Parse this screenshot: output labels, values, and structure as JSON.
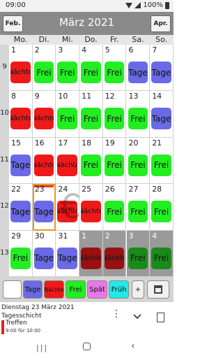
{
  "status": {
    "time": "09:00",
    "battery": "100%"
  },
  "header": {
    "prev_label": "Feb.",
    "title": "März 2021",
    "next_label": "Apr."
  },
  "weekdays": [
    "Mo.",
    "Di.",
    "Mi.",
    "Do.",
    "Fr.",
    "Sa.",
    "So."
  ],
  "weeks": [
    {
      "number": "9",
      "days": [
        {
          "day": "1",
          "shift": "Nächte"
        },
        {
          "day": "2",
          "shift": "Frei"
        },
        {
          "day": "3",
          "shift": "Frei"
        },
        {
          "day": "4",
          "shift": "Frei"
        },
        {
          "day": "5",
          "shift": "Frei"
        },
        {
          "day": "6",
          "shift": "Tage"
        },
        {
          "day": "7",
          "shift": "Tage"
        }
      ]
    },
    {
      "number": "10",
      "days": [
        {
          "day": "8",
          "shift": "Nächte"
        },
        {
          "day": "9",
          "shift": "Nächte"
        },
        {
          "day": "10",
          "shift": "Frei"
        },
        {
          "day": "11",
          "shift": "Frei"
        },
        {
          "day": "12",
          "shift": "Frei"
        },
        {
          "day": "13",
          "shift": "Frei"
        },
        {
          "day": "14",
          "shift": "Tage"
        }
      ]
    },
    {
      "number": "11",
      "days": [
        {
          "day": "15",
          "shift": "Tage"
        },
        {
          "day": "16",
          "shift": "Nächte"
        },
        {
          "day": "17",
          "shift": "Nächte"
        },
        {
          "day": "18",
          "shift": "Frei"
        },
        {
          "day": "19",
          "shift": "Frei"
        },
        {
          "day": "20",
          "shift": "Frei"
        },
        {
          "day": "21",
          "shift": "Frei"
        }
      ]
    },
    {
      "number": "12",
      "days": [
        {
          "day": "22",
          "shift": "Tage"
        },
        {
          "day": "23",
          "shift": "Tage",
          "selected": true,
          "today": true
        },
        {
          "day": "24",
          "shift": "Nächte"
        },
        {
          "day": "25",
          "shift": "Nächte"
        },
        {
          "day": "26",
          "shift": "Frei"
        },
        {
          "day": "27",
          "shift": "Frei"
        },
        {
          "day": "28",
          "shift": "Frei"
        }
      ]
    },
    {
      "number": "13",
      "days": [
        {
          "day": "29",
          "shift": "Frei"
        },
        {
          "day": "30",
          "shift": "Tage"
        },
        {
          "day": "31",
          "shift": "Tage"
        },
        {
          "day": "1",
          "shift": "Nächte",
          "other": true
        },
        {
          "day": "2",
          "shift": "Nächte",
          "other": true
        },
        {
          "day": "3",
          "shift": "Frei",
          "other": true
        },
        {
          "day": "4",
          "shift": "Frei",
          "other": true
        }
      ]
    }
  ],
  "shift_colors": {
    "Nächte": "#ee1a1a",
    "Frei": "#22ee22",
    "Tage": "#6a6ae6",
    "Nächte_other": "#9a1010",
    "Frei_other": "#1a8a1a"
  },
  "toolbar": {
    "buttons": [
      {
        "label": "",
        "color": "#ffffff"
      },
      {
        "label": "Tage",
        "color": "#6a6ae6"
      },
      {
        "label": "Nächte",
        "color": "#ee1a1a"
      },
      {
        "label": "Frei",
        "color": "#22ee22"
      },
      {
        "label": "Spät",
        "color": "#e878e8"
      },
      {
        "label": "Früh",
        "color": "#22e8e8"
      },
      {
        "label": "+",
        "color": "#f0f0f0"
      }
    ]
  },
  "info": {
    "date": "Dienstag 23 März 2021",
    "shift": "Tagesschicht",
    "event_title": "Treffen",
    "event_time": "9:00 für 10:00"
  },
  "icons": {
    "euro": "€",
    "more": "vertical-dots",
    "chevron": "chevron-down",
    "note": "note-icon"
  }
}
